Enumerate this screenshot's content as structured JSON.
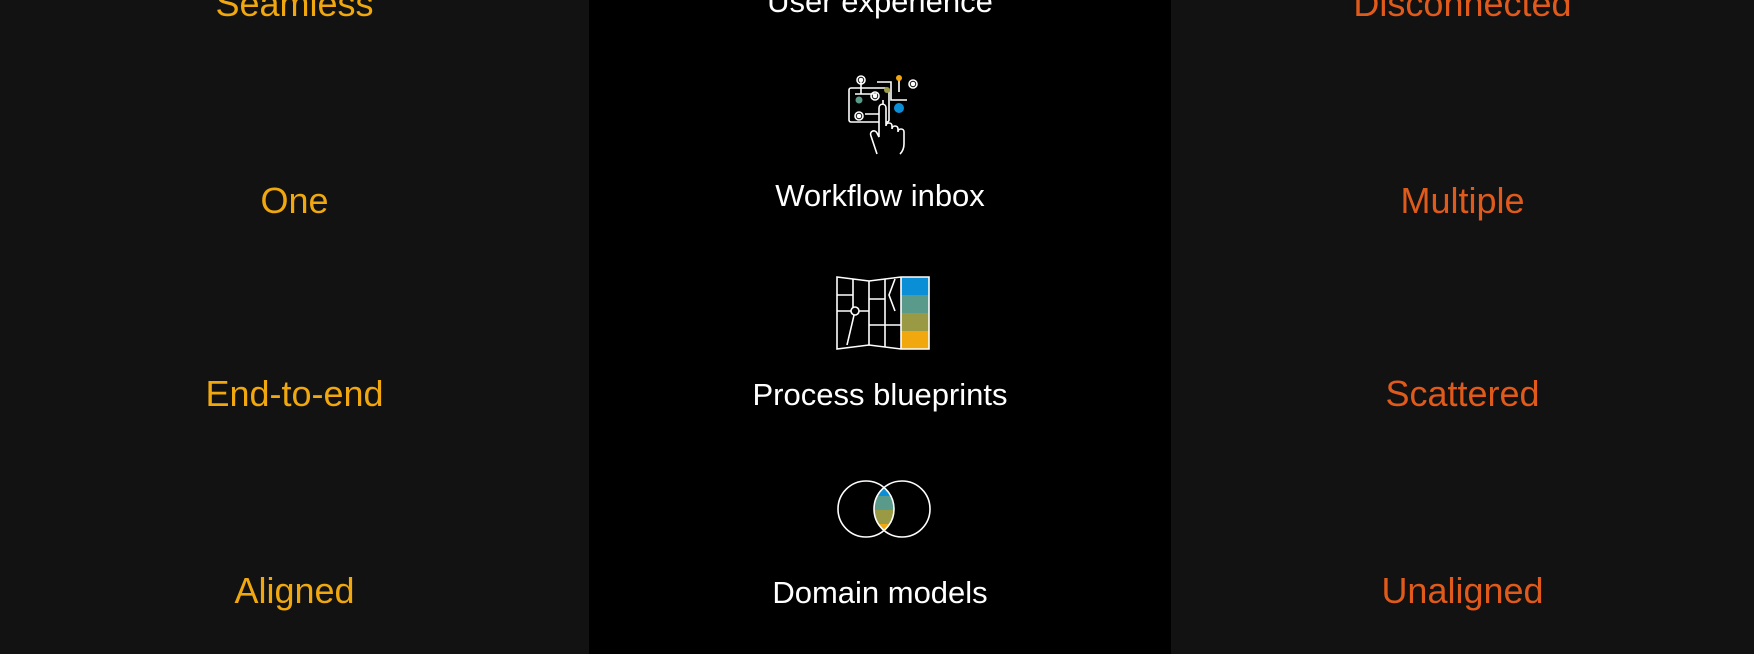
{
  "left_column": {
    "items": [
      "Seamless",
      "One",
      "End-to-end",
      "Aligned"
    ],
    "color": "#f0a80e"
  },
  "middle_column": {
    "items": [
      {
        "label": "User experience",
        "icon": "none"
      },
      {
        "label": "Workflow inbox",
        "icon": "workflow-touch-icon"
      },
      {
        "label": "Process blueprints",
        "icon": "map-blueprint-icon"
      },
      {
        "label": "Domain models",
        "icon": "venn-diagram-icon"
      }
    ],
    "color": "#ffffff"
  },
  "right_column": {
    "items": [
      "Disconnected",
      "Multiple",
      "Scattered",
      "Unaligned"
    ],
    "color": "#e05a1b"
  },
  "accent_colors": {
    "blue": "#0a8fd6",
    "teal": "#5a9a8a",
    "olive": "#9a9a44",
    "gold": "#f0a80e"
  }
}
